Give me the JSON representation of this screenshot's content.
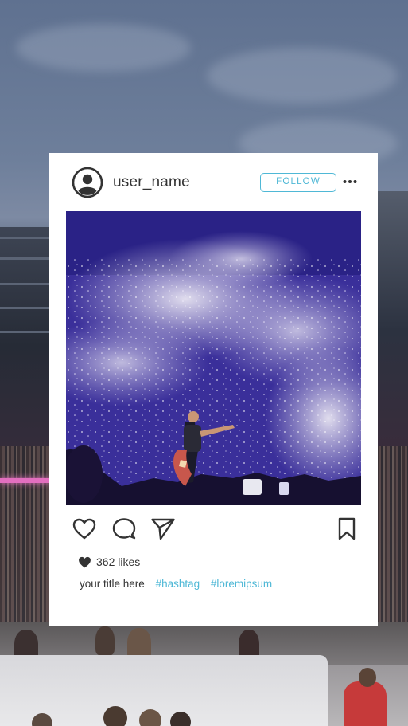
{
  "post": {
    "username": "user_name",
    "follow_label": "FOLLOW",
    "likes_text": "362 likes",
    "title": "your title here",
    "hashtags": [
      "#hashtag",
      "#loremipsum"
    ],
    "accent_color": "#4fb8d6"
  },
  "icons": {
    "avatar": "user-avatar-icon",
    "more": "more-horizontal-icon",
    "like": "heart-outline-icon",
    "comment": "comment-bubble-icon",
    "share": "paper-plane-icon",
    "save": "bookmark-icon",
    "likes": "heart-filled-icon"
  }
}
